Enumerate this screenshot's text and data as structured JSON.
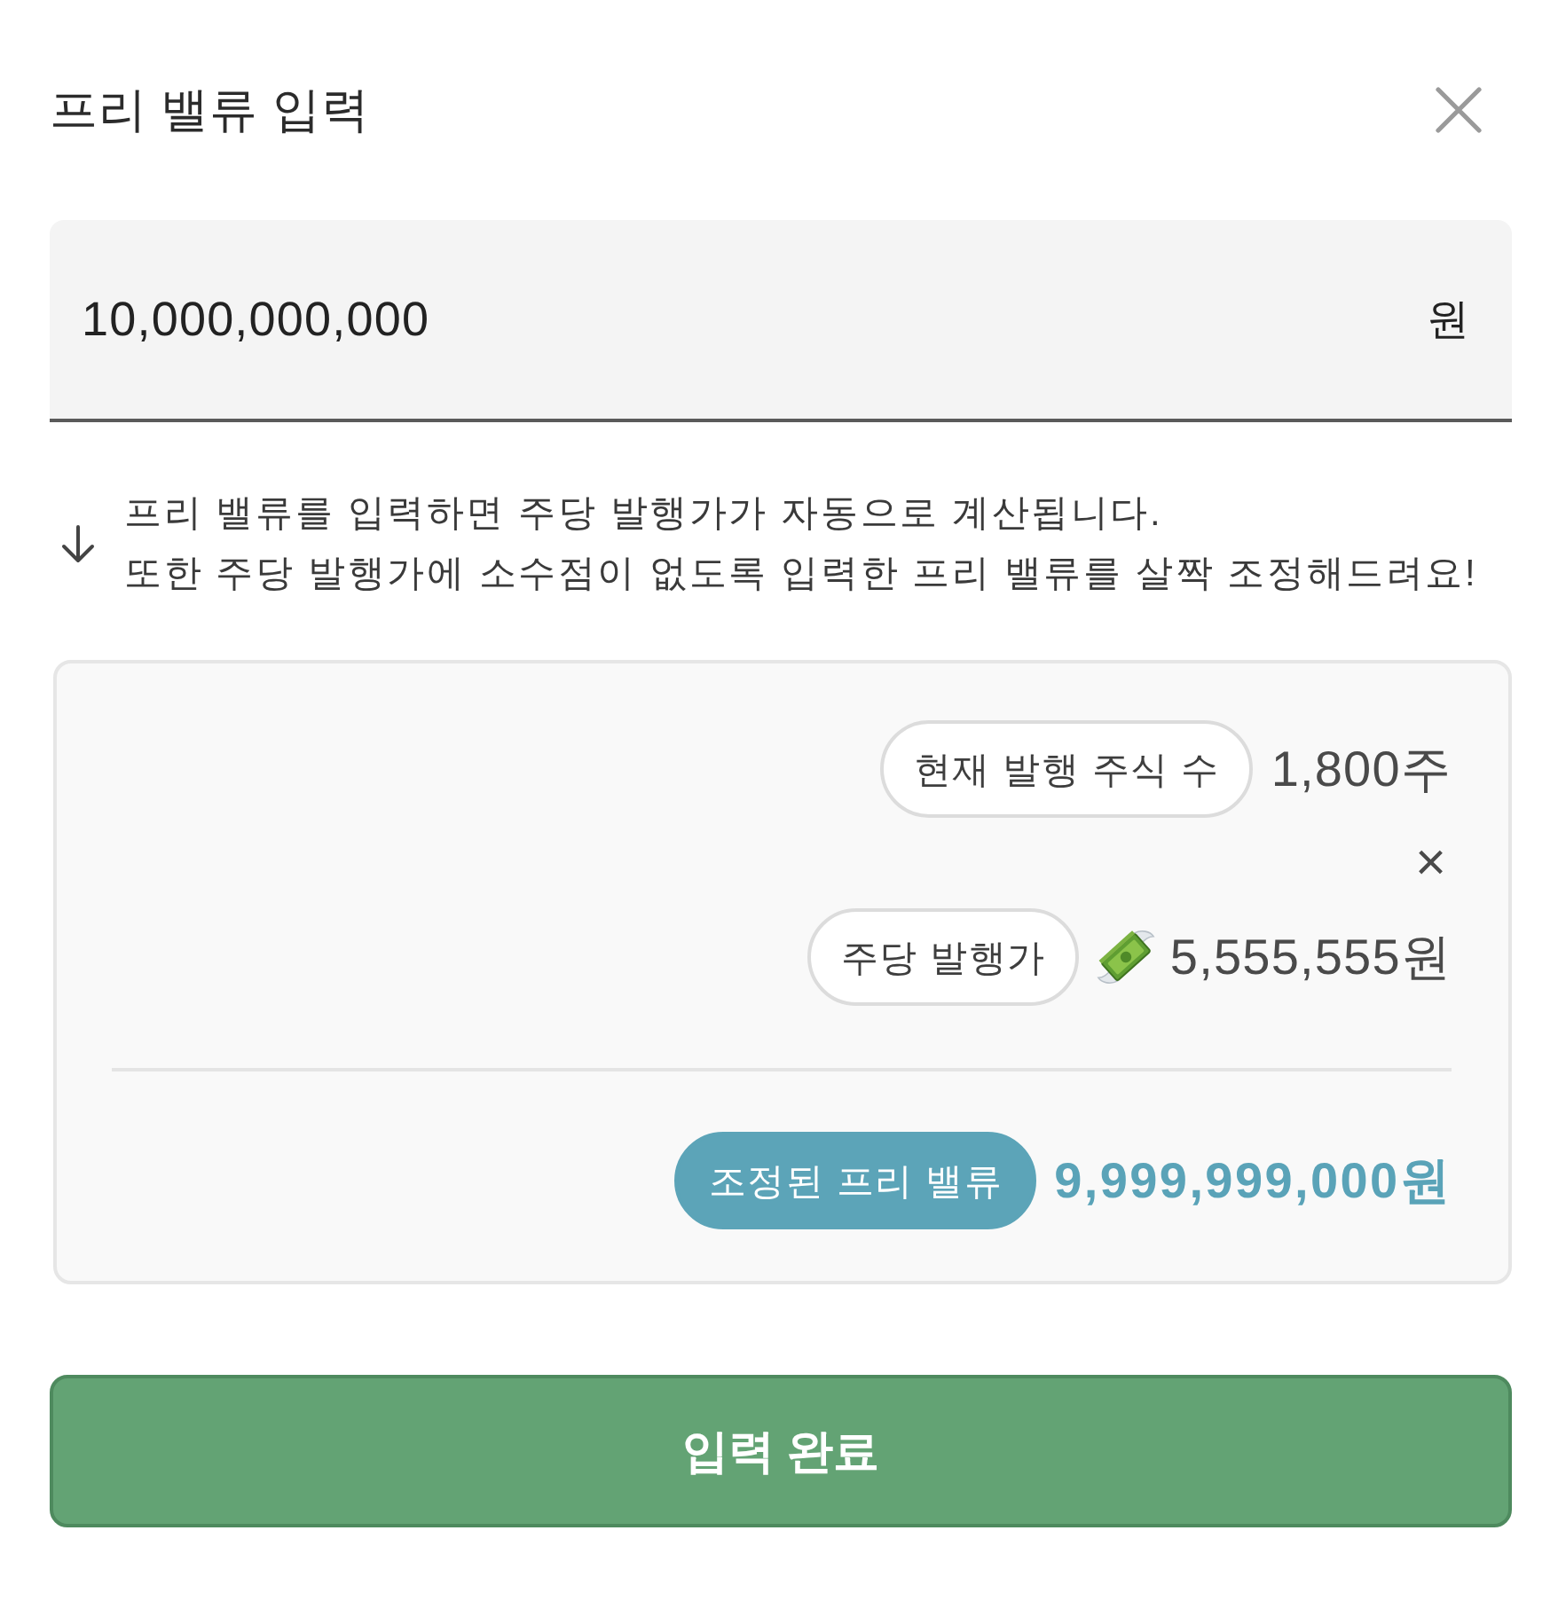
{
  "dialog": {
    "title": "프리 밸류 입력"
  },
  "amount_field": {
    "value": "10,000,000,000",
    "unit": "원"
  },
  "hint": {
    "lines": [
      "프리 밸류를 입력하면 주당 발행가가 자동으로 계산됩니다.",
      "또한 주당 발행가에 소수점이 없도록 입력한 프리 밸류를 살짝 조정해드려요!"
    ]
  },
  "calculation": {
    "rows": [
      {
        "kind": "count",
        "label": "현재 발행 주식 수",
        "value": "1,800주"
      },
      {
        "kind": "operator",
        "symbol": "×"
      },
      {
        "kind": "price",
        "label": "주당 발행가",
        "value": "5,555,555원"
      },
      {
        "kind": "divider"
      },
      {
        "kind": "result",
        "label": "조정된 프리 밸류",
        "value": "9,999,999,000원"
      }
    ]
  },
  "submit_button": {
    "label": "입력 완료"
  }
}
